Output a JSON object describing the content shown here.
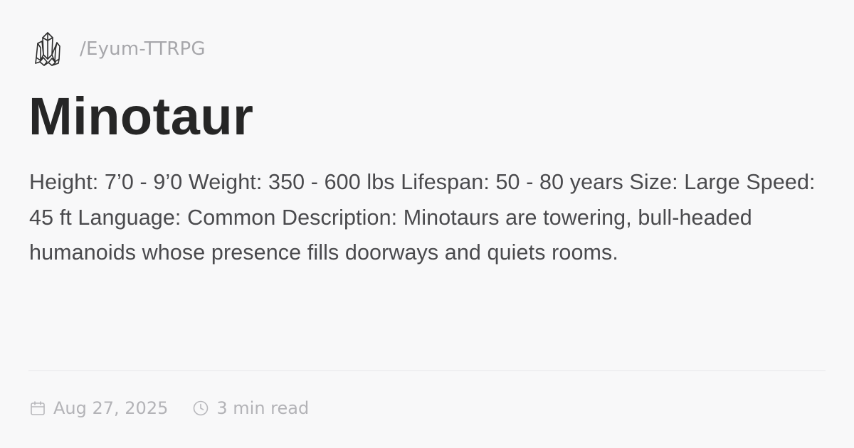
{
  "site": {
    "logo_icon": "crystal-cluster-icon",
    "path": "/Eyum-TTRPG"
  },
  "post": {
    "title": "Minotaur",
    "description": "Height: 7’0 - 9’0 Weight: 350 - 600 lbs Lifespan: 50 - 80 years Size: Large Speed: 45 ft Language: Common Description: Minotaurs are towering, bull-headed humanoids whose presence fills doorways and quiets rooms."
  },
  "meta": {
    "date_icon": "calendar-icon",
    "date": "Aug 27, 2025",
    "read_time_icon": "clock-icon",
    "read_time": "3 min read"
  },
  "colors": {
    "background": "#f8f8f9",
    "title": "#262626",
    "body_text": "#4a4a4d",
    "muted_text": "#a7a7ab",
    "divider": "#e6e6e9"
  }
}
